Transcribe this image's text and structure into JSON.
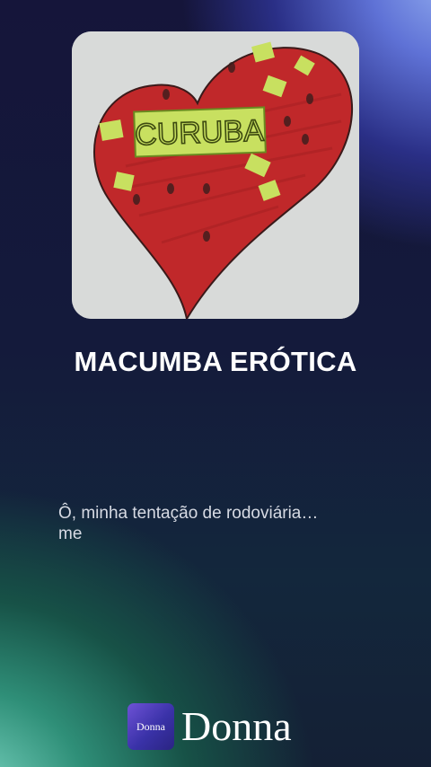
{
  "album": {
    "cover_lettering": "CURUBA",
    "title": "MACUMBA ERÓTICA"
  },
  "lyrics": {
    "line1": "Ô, minha tentação de rodoviária",
    "ellipsis": "…",
    "line2": "me"
  },
  "brand": {
    "logo_text": "Donna",
    "name": "Donna"
  },
  "colors": {
    "heart": "#c0282a",
    "label": "#c8e060",
    "paper": "#d9dbd9"
  }
}
